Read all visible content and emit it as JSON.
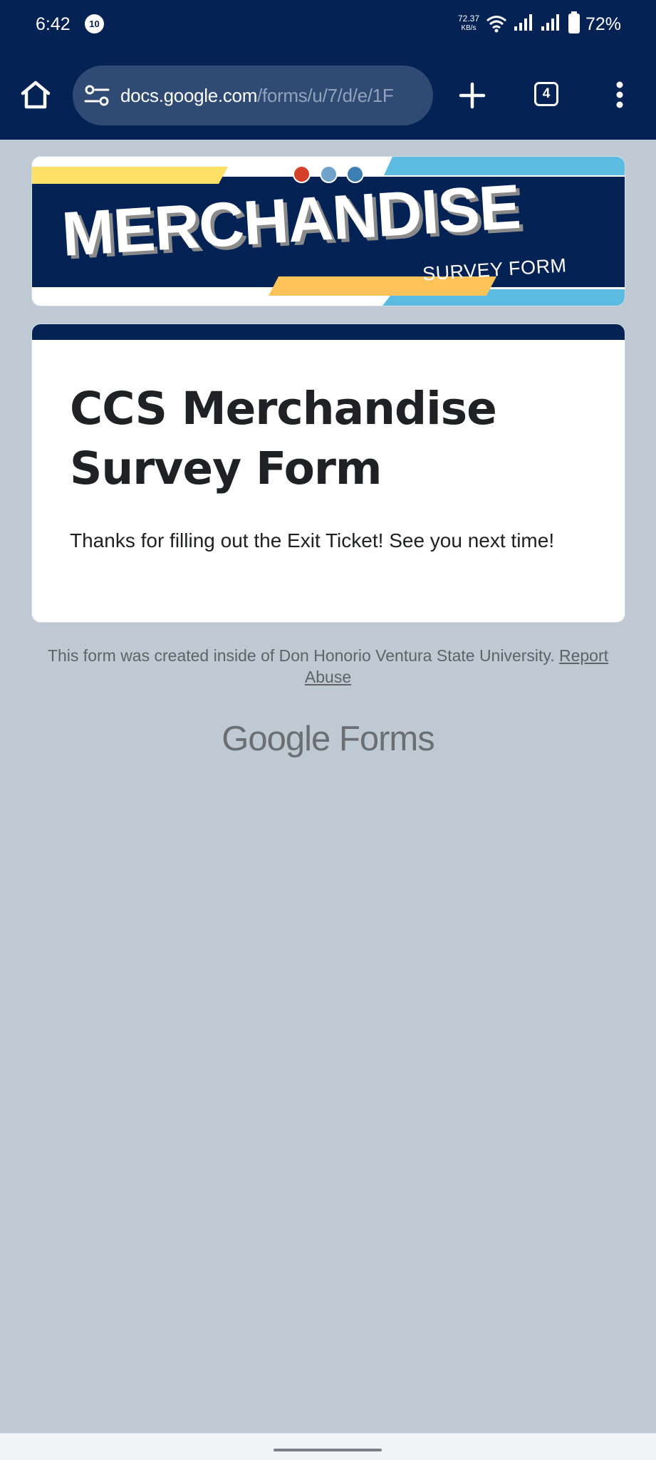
{
  "status_bar": {
    "time": "6:42",
    "notification_badge": "10",
    "net_speed": "72.37",
    "net_speed_unit": "KB/s",
    "battery_percent": "72%"
  },
  "browser": {
    "url_host": "docs.google.com",
    "url_path": "/forms/u/7/d/e/1F",
    "tab_count": "4",
    "icons": [
      "home-icon",
      "site-settings-icon",
      "plus-icon",
      "tabs-icon",
      "more-vert-icon"
    ]
  },
  "banner": {
    "title": "MERCHANDISE",
    "subtitle": "SURVEY FORM",
    "colors": {
      "navy": "#042354",
      "yellow": "#ffe066",
      "orange": "#ffc35a",
      "sky": "#5bbbe0"
    }
  },
  "form": {
    "title": "CCS Merchandise Survey Form",
    "message": "Thanks for filling out the Exit Ticket!  See you next time!"
  },
  "footer": {
    "notice": "This form was created inside of Don Honorio Ventura State University.",
    "report_link": "Report Abuse",
    "brand_google": "Google",
    "brand_forms": "Forms"
  }
}
